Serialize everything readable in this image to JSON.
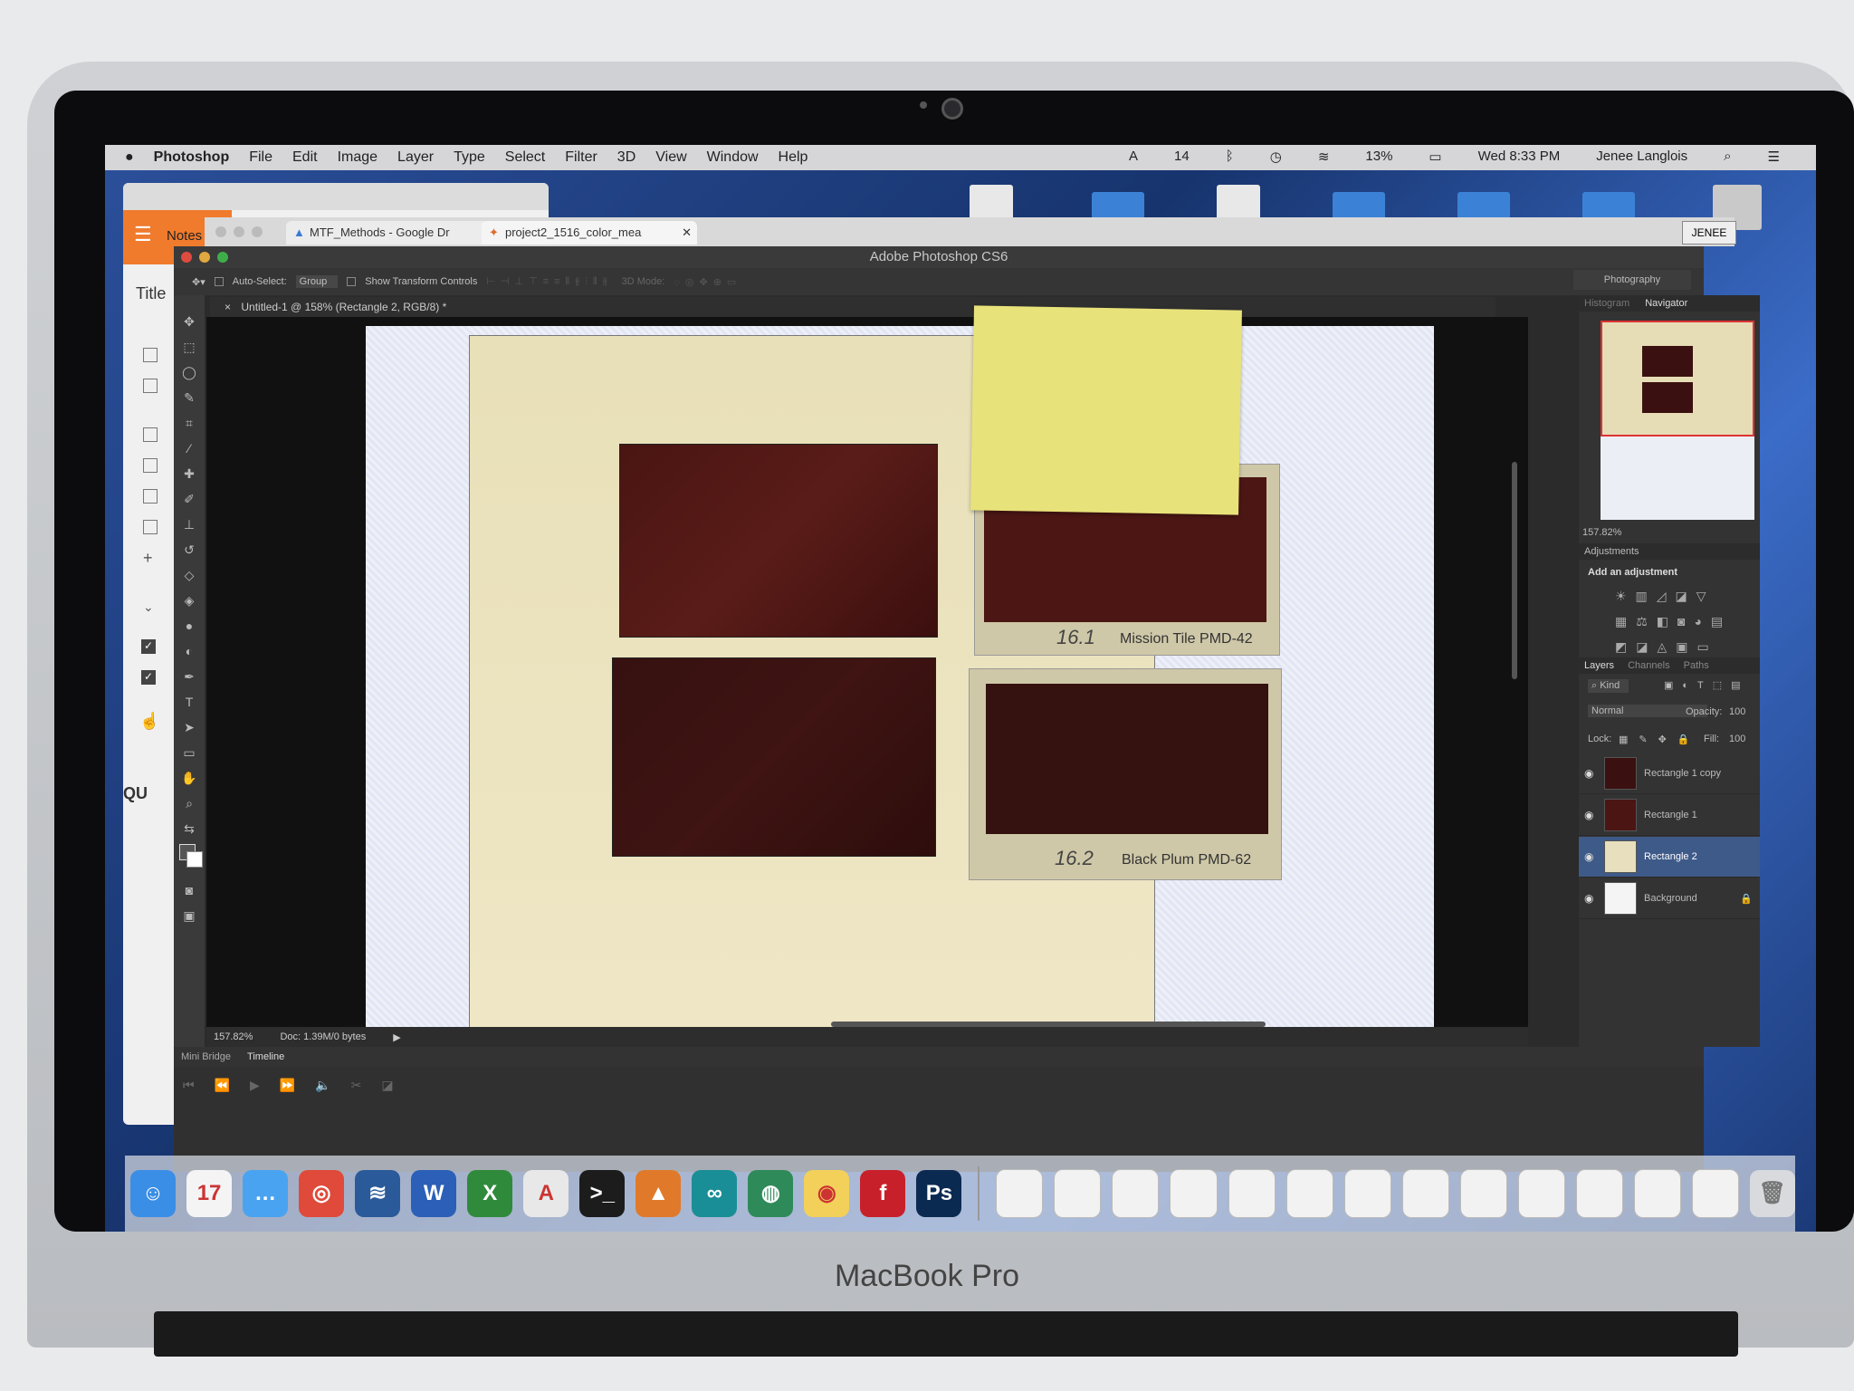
{
  "device": {
    "model": "MacBook Pro"
  },
  "menubar": {
    "apple": "",
    "app": "Photoshop",
    "items": [
      "File",
      "Edit",
      "Image",
      "Layer",
      "Type",
      "Select",
      "Filter",
      "3D",
      "View",
      "Window",
      "Help"
    ],
    "status": {
      "adobe_count": "14",
      "battery": "13%",
      "datetime": "Wed 8:33 PM",
      "user": "Jenee Langlois"
    }
  },
  "notes": {
    "title": "Notes",
    "field_title": "Title",
    "footer": "QU"
  },
  "browser": {
    "tabs": [
      "MTF_Methods - Google Dr",
      "project2_1516_color_mea"
    ],
    "profile_button": "JENEE"
  },
  "photoshop": {
    "window_title": "Adobe Photoshop CS6",
    "options": {
      "auto_select_label": "Auto-Select:",
      "auto_select_value": "Group",
      "show_transform": "Show Transform Controls",
      "mode_3d": "3D Mode:"
    },
    "workspace": "Photography",
    "doc_tab": "Untitled-1 @ 158% (Rectangle 2, RGB/8) *",
    "status": {
      "zoom": "157.82%",
      "doc": "Doc: 1.39M/0 bytes"
    },
    "bottom_tabs": [
      "Mini Bridge",
      "Timeline"
    ],
    "chips": [
      {
        "handwritten": "16.1",
        "name": "Mission Tile PMD-42"
      },
      {
        "handwritten": "16.2",
        "name": "Black Plum PMD-62"
      }
    ],
    "right_panel": {
      "nav_tabs": [
        "Histogram",
        "Navigator"
      ],
      "nav_zoom": "157.82%",
      "adjustments_title": "Adjustments",
      "add_adjustment": "Add an adjustment",
      "layer_tabs": [
        "Layers",
        "Channels",
        "Paths"
      ],
      "kind": "Kind",
      "blend_mode": "Normal",
      "opacity_label": "Opacity:",
      "opacity_value": "100",
      "lock_label": "Lock:",
      "fill_label": "Fill:",
      "fill_value": "100",
      "layers": [
        "Rectangle 1 copy",
        "Rectangle 1",
        "Rectangle 2",
        "Background"
      ]
    }
  },
  "dock": {
    "apps": [
      {
        "name": "finder",
        "glyph": "☺",
        "color": "#3a8ee6"
      },
      {
        "name": "calendar",
        "glyph": "17",
        "color": "#f4f4f4"
      },
      {
        "name": "messages",
        "glyph": "…",
        "color": "#4aa3f0"
      },
      {
        "name": "chrome",
        "glyph": "◎",
        "color": "#e04a3a"
      },
      {
        "name": "app-wave",
        "glyph": "≋",
        "color": "#2a5a9a"
      },
      {
        "name": "word",
        "glyph": "W",
        "color": "#2b5fb8"
      },
      {
        "name": "excel",
        "glyph": "X",
        "color": "#2f8a3c"
      },
      {
        "name": "acrobat",
        "glyph": "A",
        "color": "#e8e8e8"
      },
      {
        "name": "terminal",
        "glyph": ">_",
        "color": "#1c1c1c"
      },
      {
        "name": "matlab",
        "glyph": "▲",
        "color": "#e07a2a"
      },
      {
        "name": "arduino",
        "glyph": "∞",
        "color": "#1a8e96"
      },
      {
        "name": "app-leaf",
        "glyph": "◍",
        "color": "#2f8a5a"
      },
      {
        "name": "app-bulb",
        "glyph": "◉",
        "color": "#f2d05a"
      },
      {
        "name": "flash",
        "glyph": "f",
        "color": "#c8202a"
      },
      {
        "name": "photoshop",
        "glyph": "Ps",
        "color": "#0b2a52"
      }
    ]
  }
}
